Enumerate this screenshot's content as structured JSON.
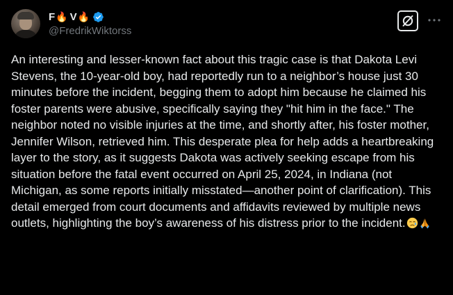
{
  "post": {
    "author": {
      "name_prefix": "F",
      "name_middle": "V",
      "fire_emoji": "🔥",
      "handle": "@FredrikWiktorss",
      "verified": true,
      "verified_color": "#1d9bf0"
    },
    "text": "An interesting and lesser-known fact about this tragic case is that Dakota Levi Stevens, the 10-year-old boy, had reportedly run to a neighbor’s house just 30 minutes before the incident, begging them to adopt him because he claimed his foster parents were abusive, specifically saying they \"hit him in the face.\" The neighbor noted no visible injuries at the time, and shortly after, his foster mother, Jennifer Wilson, retrieved him. This desperate plea for help adds a heartbreaking layer to the story, as it suggests Dakota was actively seeking escape from his situation before the fatal event occurred on April 25, 2024, in Indiana (not Michigan, as some reports initially misstated—another point of clarification). This detail emerged from court documents and affidavits reviewed by multiple news outlets, highlighting the boy’s awareness of his distress prior to the incident.",
    "trailing_emojis": [
      "sad-face",
      "folded-hands"
    ]
  },
  "icons": {
    "grok": "grok-icon",
    "more": "more-icon",
    "verified": "verified-badge-icon"
  },
  "colors": {
    "background": "#000000",
    "text": "#e7e9ea",
    "secondary_text": "#71767b",
    "accent": "#1d9bf0"
  }
}
